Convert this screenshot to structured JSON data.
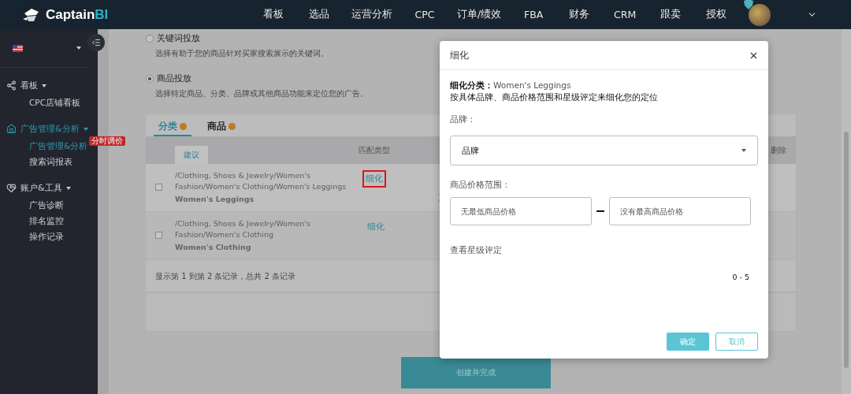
{
  "brand": {
    "name": "Captain",
    "accent": "BI"
  },
  "nav": [
    {
      "label": "看板"
    },
    {
      "label": "选品"
    },
    {
      "label": "运营分析"
    },
    {
      "label": "CPC"
    },
    {
      "label": "订单/绩效"
    },
    {
      "label": "FBA"
    },
    {
      "label": "财务"
    },
    {
      "label": "CRM"
    },
    {
      "label": "跟卖"
    },
    {
      "label": "授权"
    }
  ],
  "sidebar": {
    "sections": [
      {
        "label": "看板",
        "active": false,
        "children": [
          {
            "label": "CPC店铺看板",
            "selected": false
          }
        ]
      },
      {
        "label": "广告管理&分析",
        "active": true,
        "children": [
          {
            "label": "广告管理&分析",
            "selected": true,
            "badge": "分时调价"
          },
          {
            "label": "搜索词报表",
            "selected": false
          }
        ]
      },
      {
        "label": "账户&工具",
        "active": false,
        "children": [
          {
            "label": "广告诊断",
            "selected": false
          },
          {
            "label": "排名监控",
            "selected": false
          },
          {
            "label": "操作记录",
            "selected": false
          }
        ]
      }
    ]
  },
  "targeting_options": [
    {
      "label": "关键词投放",
      "description": "选择有助于您的商品针对买家搜索展示的关键词。",
      "selected": false
    },
    {
      "label": "商品投放",
      "description": "选择特定商品、分类、品牌或其他商品功能来定位您的广告。",
      "selected": true
    }
  ],
  "tabs": [
    {
      "label": "分类",
      "selected": true
    },
    {
      "label": "商品",
      "selected": false
    }
  ],
  "table": {
    "subtab": "建议",
    "match_column": "匹配类型",
    "delete_column": "删除",
    "rows": [
      {
        "path": "/Clothing, Shoes & Jewelry/Women's Fashion/Women's Clothing/Women's Leggings",
        "name": "Women's Leggings",
        "action": "细化",
        "checked": false,
        "highlighted": true
      },
      {
        "path": "/Clothing, Shoes & Jewelry/Women's Fashion/Women's Clothing",
        "name": "Women's Clothing",
        "action": "细化",
        "checked": false,
        "highlighted": false
      }
    ],
    "footer": "显示第 1 到第 2 条记录，总共 2 条记录"
  },
  "submit": "创建并完成",
  "modal": {
    "title": "细化",
    "category_label": "细化分类：",
    "category": "Women's Leggings",
    "description": "按具体品牌、商品价格范围和星级评定来细化您的定位",
    "brand_label": "品牌：",
    "brand_value": "品牌",
    "price_label": "商品价格范围：",
    "min_placeholder": "无最低商品价格",
    "max_placeholder": "没有最高商品价格",
    "rating_label": "查看星级评定",
    "rating_range": "0 - 5",
    "confirm": "确定",
    "cancel": "取消"
  }
}
